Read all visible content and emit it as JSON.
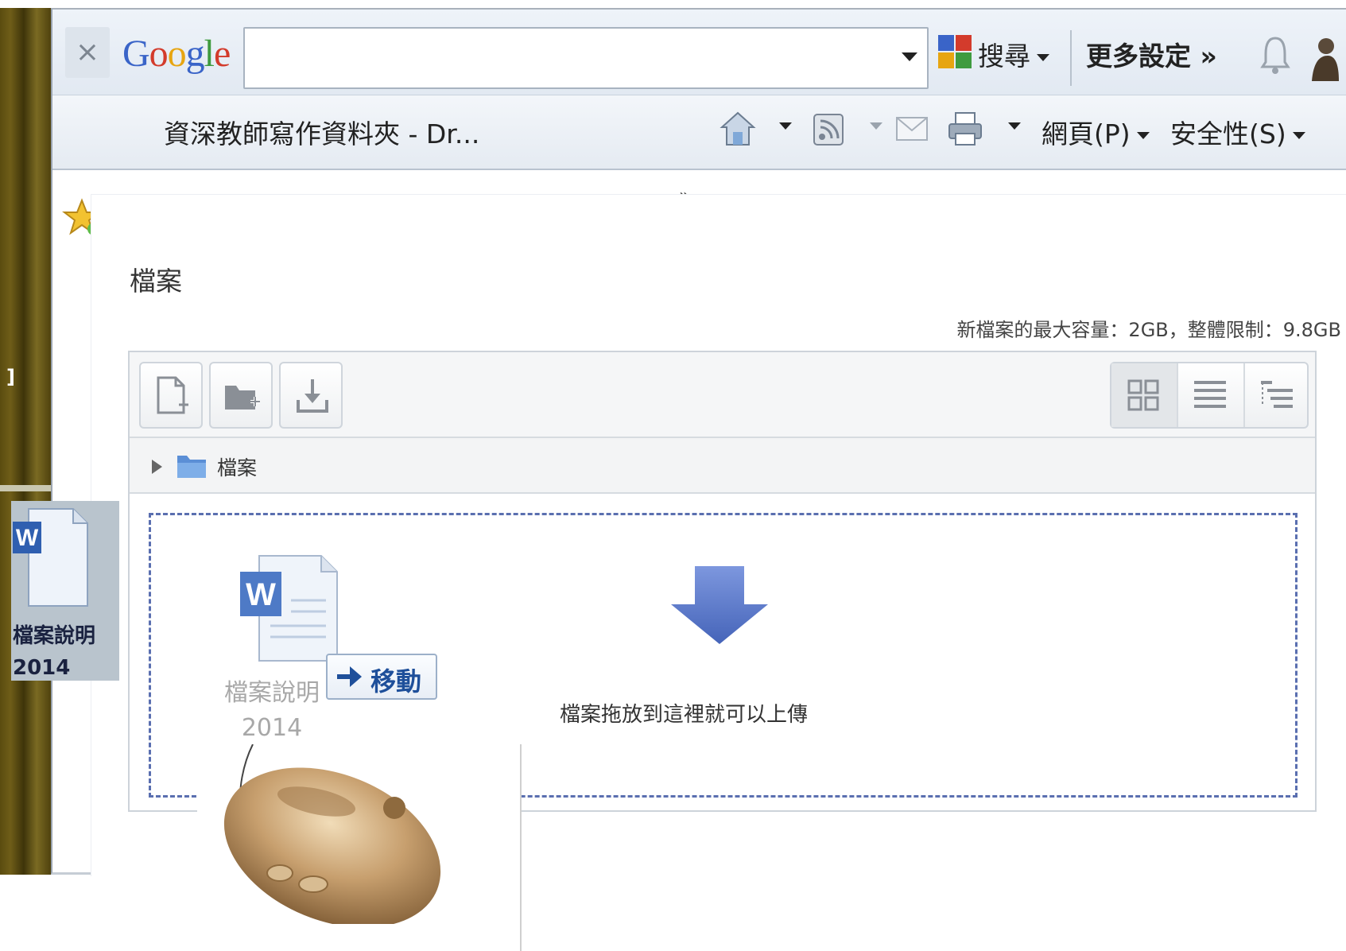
{
  "google_toolbar": {
    "close_label": "×",
    "logo_letters": [
      "G",
      "o",
      "o",
      "g",
      "l",
      "e"
    ],
    "search_value": "",
    "search_button_label": "搜尋",
    "more_settings_label": "更多設定 »"
  },
  "command_bar": {
    "favorite_link_label": "資深教師寫作資料夾 - Dr...",
    "overflow_label": "»",
    "page_menu_label": "網頁(P)",
    "safety_menu_label": "安全性(S)"
  },
  "desktop": {
    "edge_fragment": "]",
    "file_name_line1": "檔案說明",
    "file_name_line2": "2014"
  },
  "file_manager": {
    "section_label": "檔案",
    "limits_text": "新檔案的最大容量：2GB，整體限制：9.8GB",
    "path_label": "檔案",
    "drop_text": "檔案拖放到這裡就可以上傳",
    "toolbar_icons": [
      "add-file-icon",
      "create-folder-icon",
      "download-icon"
    ],
    "view_icons": [
      "grid-view-icon",
      "list-view-icon",
      "tree-view-icon"
    ],
    "active_view": "grid"
  },
  "drag": {
    "ghost_name_line1": "檔案說明",
    "ghost_name_line2": "2014",
    "move_badge_label": "移動"
  },
  "mouse_photo": {
    "caption": ""
  },
  "colors": {
    "drop_border": "#5a6fb0",
    "arrow_blue": "#4f6fc7",
    "move_text": "#1e4f9a"
  }
}
